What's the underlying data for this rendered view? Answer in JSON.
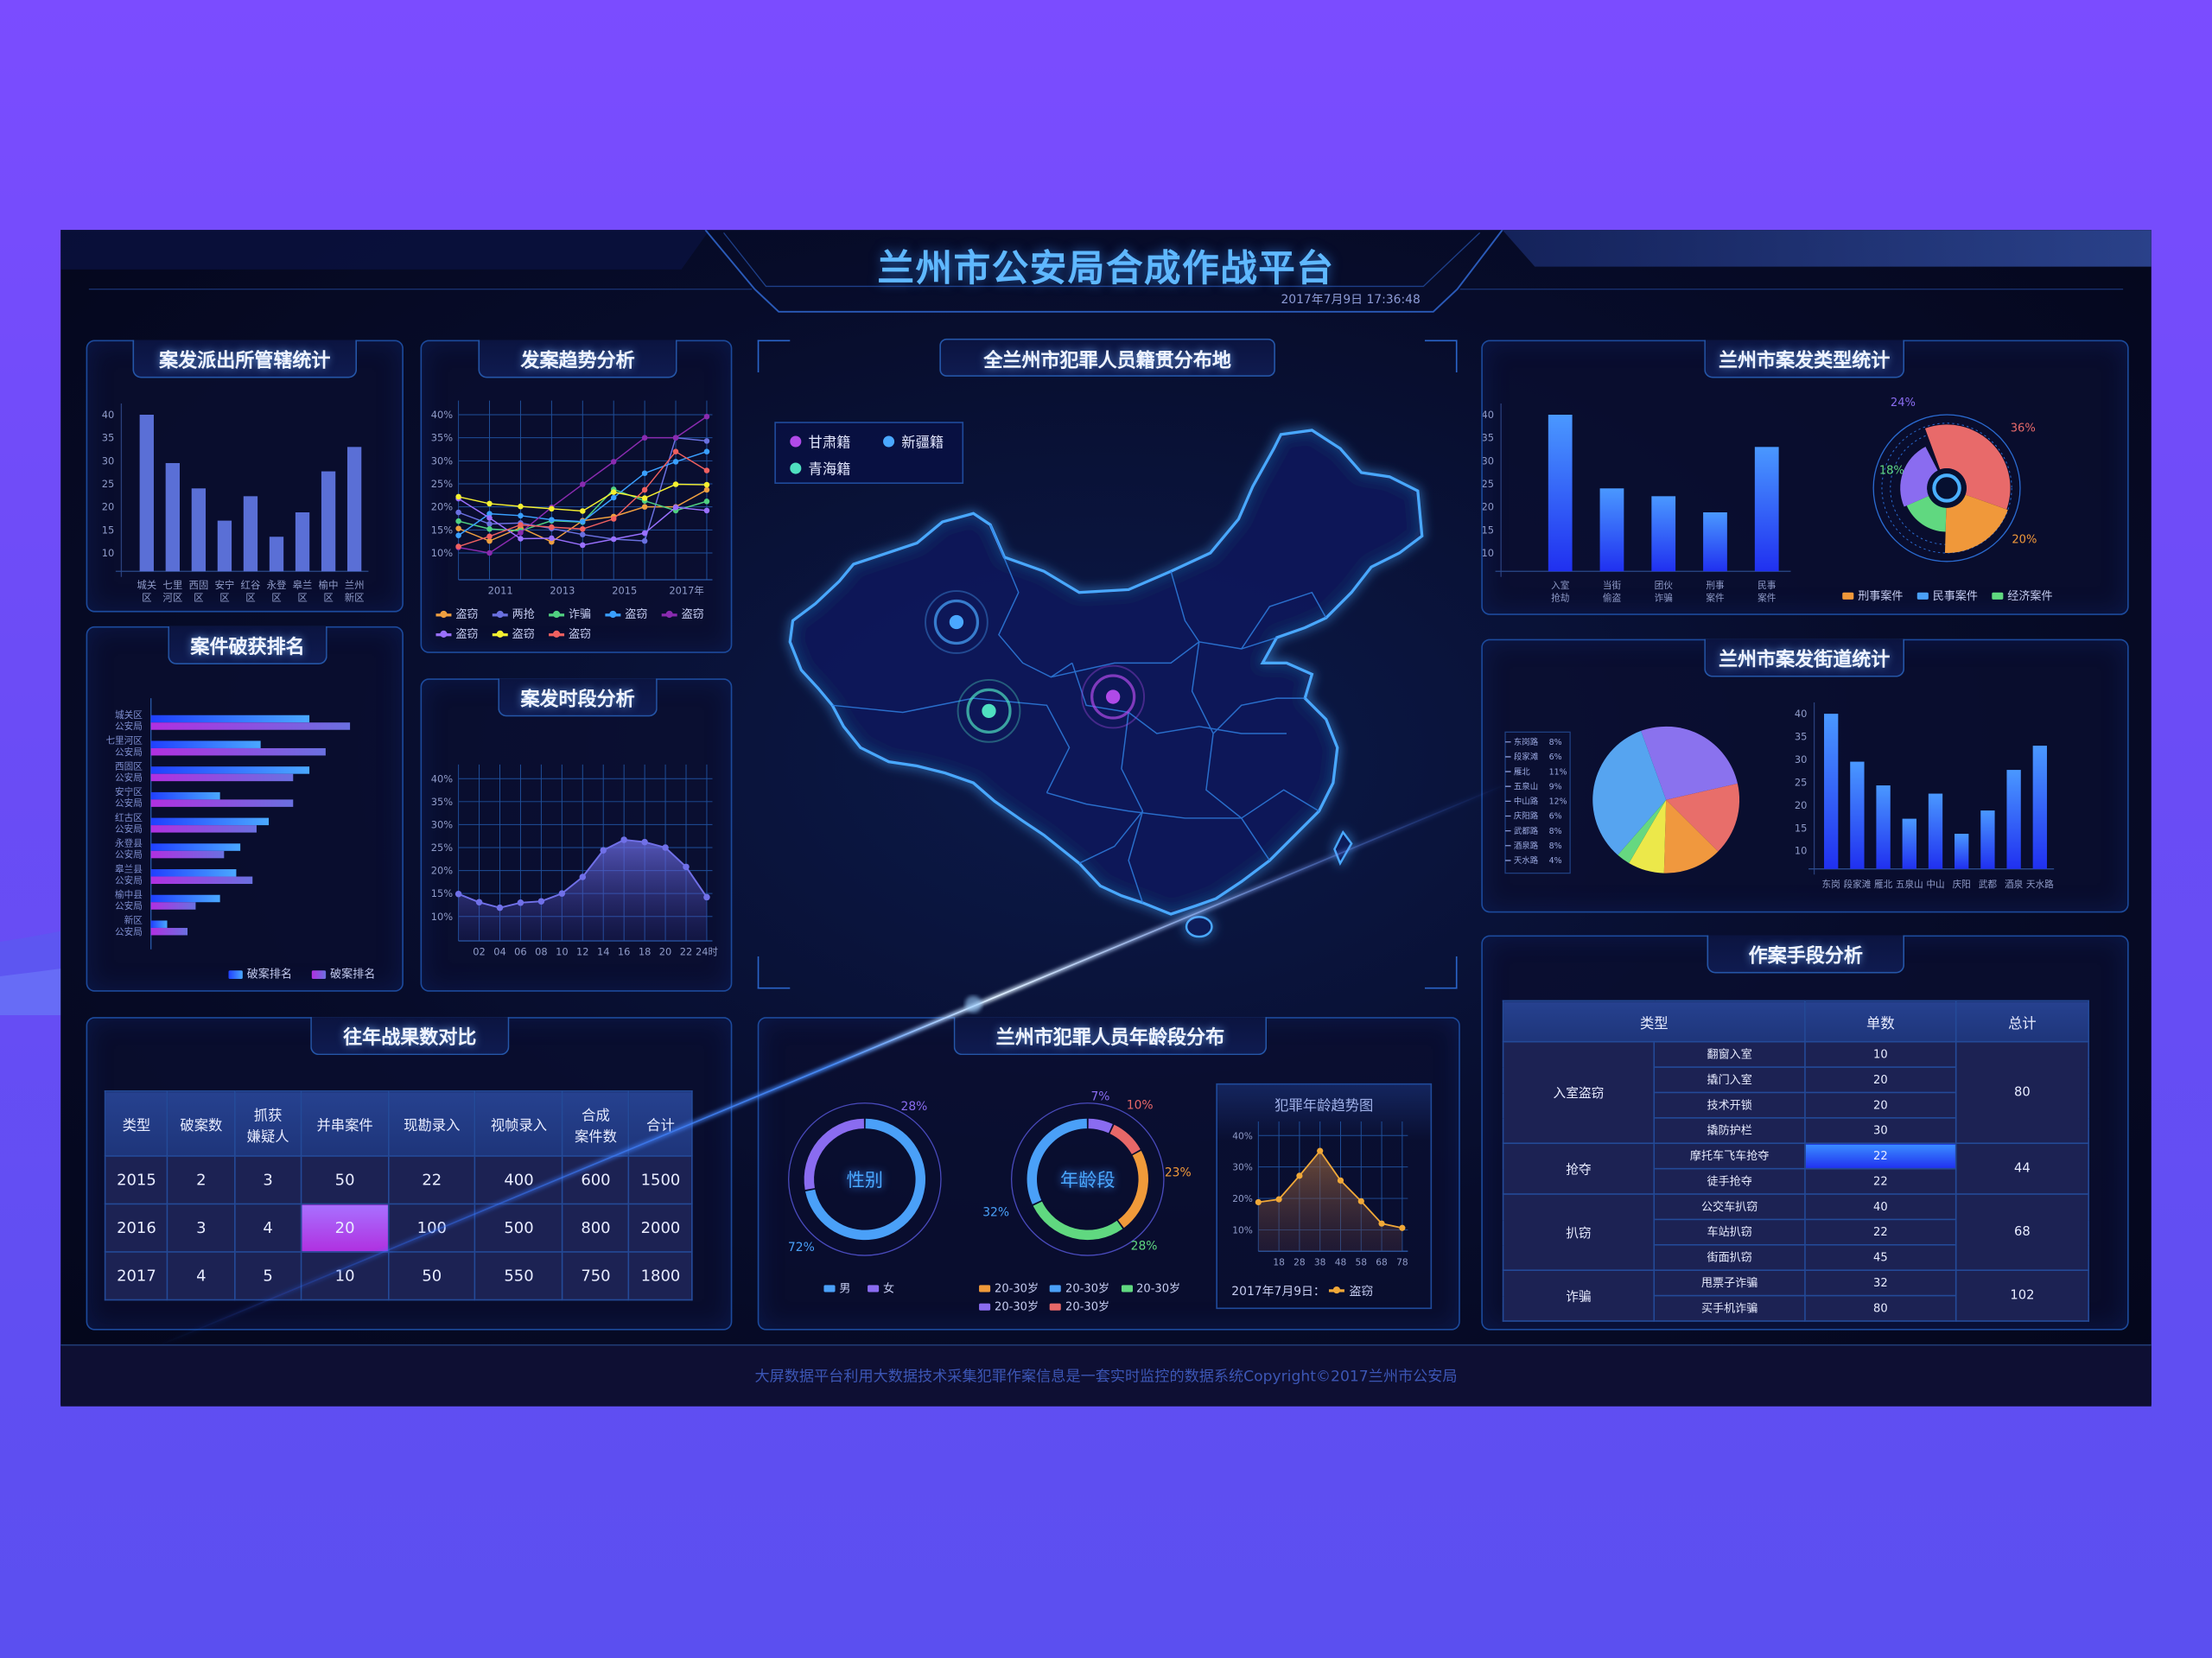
{
  "header": {
    "title": "兰州市公安局合成作战平台",
    "datetime": "2017年7月9日 17:36:48"
  },
  "footer": {
    "text": "大屏数据平台利用大数据技术采集犯罪作案信息是一套实时监控的数据系统Copyright©2017兰州市公安局"
  },
  "panels": {
    "station": {
      "title": "案发派出所管辖统计"
    },
    "trend": {
      "title": "发案趋势分析"
    },
    "ranking": {
      "title": "案件破获排名"
    },
    "period": {
      "title": "案发时段分析"
    },
    "map": {
      "title": "全兰州市犯罪人员籍贯分布地"
    },
    "history": {
      "title": "往年战果数对比"
    },
    "age": {
      "title": "兰州市犯罪人员年龄段分布"
    },
    "types": {
      "title": "兰州市案发类型统计"
    },
    "streets": {
      "title": "兰州市案发街道统计"
    },
    "methods": {
      "title": "作案手段分析"
    }
  },
  "map": {
    "legend": [
      {
        "label": "甘肃籍",
        "color": "#b04ae8"
      },
      {
        "label": "新疆籍",
        "color": "#4aa8ff"
      },
      {
        "label": "青海籍",
        "color": "#4fe0c0"
      }
    ],
    "markers": [
      {
        "origin": "新疆籍",
        "color": "#4aa8ff"
      },
      {
        "origin": "青海籍",
        "color": "#4fe0c0"
      },
      {
        "origin": "甘肃籍",
        "color": "#b04ae8"
      }
    ]
  },
  "history_table": {
    "headers": [
      "类型",
      "破案数",
      "抓获\n嫌疑人",
      "并串案件",
      "现勘录入",
      "视帧录入",
      "合成\n案件数",
      "合计"
    ],
    "rows": [
      [
        "2015",
        "2",
        "3",
        "50",
        "22",
        "400",
        "600",
        "1500"
      ],
      [
        "2016",
        "3",
        "4",
        "20",
        "100",
        "500",
        "800",
        "2000"
      ],
      [
        "2017",
        "4",
        "5",
        "10",
        "50",
        "550",
        "750",
        "1800"
      ]
    ],
    "highlight": {
      "row": 1,
      "col": 3,
      "color": "#a040e0"
    }
  },
  "methods_table": {
    "headers": [
      "类型",
      "单数",
      "总计"
    ],
    "groups": [
      {
        "type": "入室盗窃",
        "total": "80",
        "items": [
          {
            "name": "翻窗入室",
            "count": "10"
          },
          {
            "name": "撬门入室",
            "count": "20"
          },
          {
            "name": "技术开锁",
            "count": "20"
          },
          {
            "name": "撬防护栏",
            "count": "30"
          }
        ]
      },
      {
        "type": "抢夺",
        "total": "44",
        "items": [
          {
            "name": "摩托车飞车抢夺",
            "count": "22",
            "highlight": true
          },
          {
            "name": "徒手抢夺",
            "count": "22"
          }
        ]
      },
      {
        "type": "扒窃",
        "total": "68",
        "items": [
          {
            "name": "公交车扒窃",
            "count": "40"
          },
          {
            "name": "车站扒窃",
            "count": "22"
          },
          {
            "name": "街面扒窃",
            "count": "45"
          }
        ]
      },
      {
        "type": "诈骗",
        "total": "102",
        "items": [
          {
            "name": "甩票子诈骗",
            "count": "32"
          },
          {
            "name": "买手机诈骗",
            "count": "80"
          }
        ]
      }
    ]
  },
  "chart_data": [
    {
      "id": "station",
      "type": "bar",
      "title": "案发派出所管辖统计",
      "categories": [
        [
          "城关",
          "区"
        ],
        [
          "七里",
          "河区"
        ],
        [
          "西固",
          "区"
        ],
        [
          "安宁",
          "区"
        ],
        [
          "红谷",
          "区"
        ],
        [
          "永登",
          "区"
        ],
        [
          "皋兰",
          "区"
        ],
        [
          "榆中",
          "区"
        ],
        [
          "兰州",
          "新区"
        ]
      ],
      "values": [
        40,
        29.5,
        24,
        17,
        22.3,
        13.5,
        18.8,
        27.7,
        33
      ],
      "yticks": [
        10,
        15,
        20,
        25,
        30,
        35,
        40
      ],
      "ylim": [
        6,
        40
      ],
      "color": "#5a6fd6"
    },
    {
      "id": "trend",
      "type": "line",
      "title": "发案趋势分析",
      "x": [
        2010,
        2011,
        2012,
        2013,
        2014,
        2015,
        2016,
        2017,
        2018
      ],
      "xticklabels": [
        {
          "x": 2011,
          "label": "2011"
        },
        {
          "x": 2013,
          "label": "2013"
        },
        {
          "x": 2015,
          "label": "2015"
        },
        {
          "x": 2017,
          "label": "2017年"
        }
      ],
      "yticks": [
        10,
        15,
        20,
        25,
        30,
        35,
        40
      ],
      "ylim": [
        10,
        40
      ],
      "yunit": "%",
      "series": [
        {
          "name": "盗窃",
          "color": "#f0a040",
          "values": [
            15.3,
            12.6,
            15.5,
            12.4,
            17,
            17.9,
            20,
            20,
            23.7
          ]
        },
        {
          "name": "两抢",
          "color": "#6a70e0",
          "values": [
            18.8,
            16.3,
            16.5,
            15.3,
            14,
            13,
            12.6,
            35,
            34.3
          ]
        },
        {
          "name": "诈骗",
          "color": "#50d080",
          "values": [
            16.9,
            15.2,
            14.8,
            17,
            16.7,
            23.8,
            21.3,
            19.2,
            21.2
          ]
        },
        {
          "name": "盗窃",
          "color": "#3aa0ff",
          "values": [
            13.8,
            18.5,
            18.1,
            17.2,
            16.8,
            22,
            27.3,
            29.8,
            32
          ]
        },
        {
          "name": "盗窃",
          "color": "#8a2bb0",
          "values": [
            11.2,
            10,
            14.4,
            19.9,
            24.9,
            29.8,
            35,
            35,
            39.6
          ]
        },
        {
          "name": "盗窃",
          "color": "#9a70ff",
          "values": [
            21.8,
            17.6,
            13.1,
            13.2,
            11.7,
            13,
            14.3,
            19.9,
            19.2
          ]
        },
        {
          "name": "盗窃",
          "color": "#f5f030",
          "values": [
            22.2,
            20.7,
            20.1,
            19.6,
            19.1,
            23.2,
            21.9,
            24.9,
            24.8
          ]
        },
        {
          "name": "盗窃",
          "color": "#f06060",
          "values": [
            11.4,
            13.6,
            16.1,
            15.6,
            15.2,
            17.4,
            23.7,
            32,
            27.9
          ]
        }
      ]
    },
    {
      "id": "ranking",
      "type": "bar",
      "orientation": "horizontal",
      "title": "案件破获排名",
      "categories": [
        [
          "城关区",
          "公安局"
        ],
        [
          "七里河区",
          "公安局"
        ],
        [
          "西固区",
          "公安局"
        ],
        [
          "安宁区",
          "公安局"
        ],
        [
          "红古区",
          "公安局"
        ],
        [
          "永登县",
          "公安局"
        ],
        [
          "皋兰县",
          "公安局"
        ],
        [
          "榆中县",
          "公安局"
        ],
        [
          "新区",
          "公安局"
        ]
      ],
      "series": [
        {
          "name": "破案排名",
          "color": "#3a7bff",
          "values": [
            39,
            27,
            39,
            17,
            29,
            22,
            21,
            17,
            4
          ]
        },
        {
          "name": "破案排名",
          "color": "#a040e0",
          "values": [
            49,
            43,
            35,
            35,
            26,
            18,
            25,
            11,
            9
          ]
        }
      ],
      "xlim": [
        0,
        50
      ]
    },
    {
      "id": "period",
      "type": "area",
      "title": "案发时段分析",
      "x": [
        0,
        2,
        4,
        6,
        8,
        10,
        12,
        14,
        16,
        18,
        20,
        22,
        24
      ],
      "xticklabels": [
        {
          "x": 2,
          "label": "02"
        },
        {
          "x": 4,
          "label": "04"
        },
        {
          "x": 6,
          "label": "06"
        },
        {
          "x": 8,
          "label": "08"
        },
        {
          "x": 10,
          "label": "10"
        },
        {
          "x": 12,
          "label": "12"
        },
        {
          "x": 14,
          "label": "14"
        },
        {
          "x": 16,
          "label": "16"
        },
        {
          "x": 18,
          "label": "18"
        },
        {
          "x": 20,
          "label": "20"
        },
        {
          "x": 22,
          "label": "22"
        },
        {
          "x": 24,
          "label": "24时"
        }
      ],
      "yticks": [
        10,
        15,
        20,
        25,
        30,
        35,
        40
      ],
      "ylim": [
        5,
        40
      ],
      "yunit": "%",
      "series": [
        {
          "name": "案发比例",
          "color": "#7070e8",
          "values": [
            14.9,
            13.1,
            11.9,
            13,
            13.3,
            15,
            18.6,
            24.4,
            26.7,
            26.2,
            25,
            20.8,
            14.2
          ]
        }
      ]
    },
    {
      "id": "gender",
      "type": "pie",
      "title": "性别",
      "slices": [
        {
          "label": "男",
          "value": 72,
          "color": "#4aa0f8"
        },
        {
          "label": "女",
          "value": 28,
          "color": "#8a6cf0"
        }
      ]
    },
    {
      "id": "agegroup",
      "type": "pie",
      "title": "年龄段",
      "slices": [
        {
          "label": "20-30岁",
          "value": 7,
          "color": "#8a6cf0"
        },
        {
          "label": "20-30岁",
          "value": 10,
          "color": "#e86868"
        },
        {
          "label": "20-30岁",
          "value": 23,
          "color": "#f09a3a"
        },
        {
          "label": "20-30岁",
          "value": 28,
          "color": "#60d880"
        },
        {
          "label": "20-30岁",
          "value": 32,
          "color": "#4aa0f8"
        }
      ],
      "legend_order": [
        2,
        4,
        3,
        0,
        1
      ]
    },
    {
      "id": "agetrend",
      "type": "area",
      "title": "犯罪年龄趋势图",
      "x": [
        8,
        18,
        28,
        38,
        48,
        58,
        68,
        78
      ],
      "xticklabels": [
        {
          "x": 18,
          "label": "18"
        },
        {
          "x": 28,
          "label": "28"
        },
        {
          "x": 38,
          "label": "38"
        },
        {
          "x": 48,
          "label": "48"
        },
        {
          "x": 58,
          "label": "58"
        },
        {
          "x": 68,
          "label": "68"
        },
        {
          "x": 78,
          "label": "78"
        }
      ],
      "yticks": [
        10,
        20,
        30,
        40
      ],
      "ylim": [
        5,
        40
      ],
      "yunit": "%",
      "caption": "2017年7月9日：",
      "series": [
        {
          "name": "盗窃",
          "color": "#f0a838",
          "values": [
            18.8,
            19.7,
            27.2,
            35.1,
            25.7,
            19.1,
            12,
            10.6
          ]
        }
      ]
    },
    {
      "id": "types",
      "type": "bar",
      "title": "兰州市案发类型统计",
      "categories": [
        [
          "入室",
          "抢劫"
        ],
        [
          "当街",
          "偷盗"
        ],
        [
          "团伙",
          "诈骗"
        ],
        [
          "刑事",
          "案件"
        ],
        [
          "民事",
          "案件"
        ]
      ],
      "values": [
        40,
        24,
        22.3,
        18.8,
        33
      ],
      "yticks": [
        10,
        15,
        20,
        25,
        30,
        35,
        40
      ],
      "ylim": [
        6,
        40
      ],
      "color": "gradient-blue"
    },
    {
      "id": "typesrose",
      "type": "pie",
      "variant": "rose",
      "slices": [
        {
          "label": "36%",
          "value": 36,
          "color": "#e86a6a"
        },
        {
          "label": "20%",
          "value": 20,
          "color": "#f0983a"
        },
        {
          "label": "18%",
          "value": 18,
          "color": "#60d880"
        },
        {
          "label": "24%",
          "value": 24,
          "color": "#8a6cf0"
        }
      ],
      "legend": [
        {
          "label": "刑事案件",
          "color": "#f0983a"
        },
        {
          "label": "民事案件",
          "color": "#4aa0f8"
        },
        {
          "label": "经济案件",
          "color": "#60d880"
        }
      ]
    },
    {
      "id": "streetpie",
      "type": "pie",
      "slices": [
        {
          "value": 27,
          "color": "#8a72ee"
        },
        {
          "value": 16,
          "color": "#e86e6a"
        },
        {
          "value": 13,
          "color": "#f0983e"
        },
        {
          "value": 8,
          "color": "#ece84a"
        },
        {
          "value": 3,
          "color": "#66d880"
        },
        {
          "value": 33,
          "color": "#56a4f0"
        }
      ],
      "list": [
        {
          "label": "东岗路",
          "pct": "8%"
        },
        {
          "label": "段家滩",
          "pct": "6%"
        },
        {
          "label": "雁北",
          "pct": "11%"
        },
        {
          "label": "五泉山",
          "pct": "9%"
        },
        {
          "label": "中山路",
          "pct": "12%"
        },
        {
          "label": "庆阳路",
          "pct": "6%"
        },
        {
          "label": "武都路",
          "pct": "8%"
        },
        {
          "label": "酒泉路",
          "pct": "8%"
        },
        {
          "label": "天水路",
          "pct": "4%"
        }
      ]
    },
    {
      "id": "streets",
      "type": "bar",
      "title": "兰州市案发街道统计",
      "categories": [
        [
          "东岗"
        ],
        [
          "段家滩"
        ],
        [
          "雁北"
        ],
        [
          "五泉山"
        ],
        [
          "中山"
        ],
        [
          "庆阳"
        ],
        [
          "武都"
        ],
        [
          "酒泉"
        ],
        [
          "天水路"
        ]
      ],
      "values": [
        40,
        29.5,
        24.3,
        17,
        22.5,
        13.7,
        18.8,
        27.7,
        33
      ],
      "yticks": [
        10,
        15,
        20,
        25,
        30,
        35,
        40
      ],
      "ylim": [
        6,
        40
      ],
      "color": "gradient-blue"
    }
  ]
}
